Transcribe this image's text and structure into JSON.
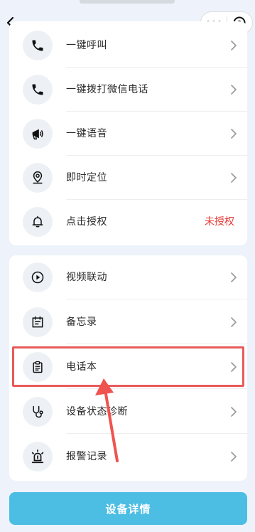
{
  "header": {
    "back_icon": "chevron-left-icon",
    "more_icon": "more-dots-icon",
    "close_icon": "target-close-icon"
  },
  "card1": {
    "items": [
      {
        "label": "一键呼叫",
        "icon": "phone-icon"
      },
      {
        "label": "一键拨打微信电话",
        "icon": "phone-icon"
      },
      {
        "label": "一键语音",
        "icon": "megaphone-icon"
      },
      {
        "label": "即时定位",
        "icon": "location-pin-icon"
      },
      {
        "label": "点击授权",
        "icon": "bell-icon",
        "status": "未授权"
      }
    ]
  },
  "card2": {
    "items": [
      {
        "label": "视频联动",
        "icon": "play-circle-icon"
      },
      {
        "label": "备忘录",
        "icon": "calendar-note-icon"
      },
      {
        "label": "电话本",
        "icon": "clipboard-icon"
      },
      {
        "label": "设备状态诊断",
        "icon": "stethoscope-icon"
      },
      {
        "label": "报警记录",
        "icon": "alarm-light-icon"
      }
    ]
  },
  "footer": {
    "detail_button_label": "设备详情"
  },
  "colors": {
    "accent": "#4cbde3",
    "warning_text": "#e53935",
    "highlight": "#e85a5a",
    "background": "#eef3fb"
  }
}
